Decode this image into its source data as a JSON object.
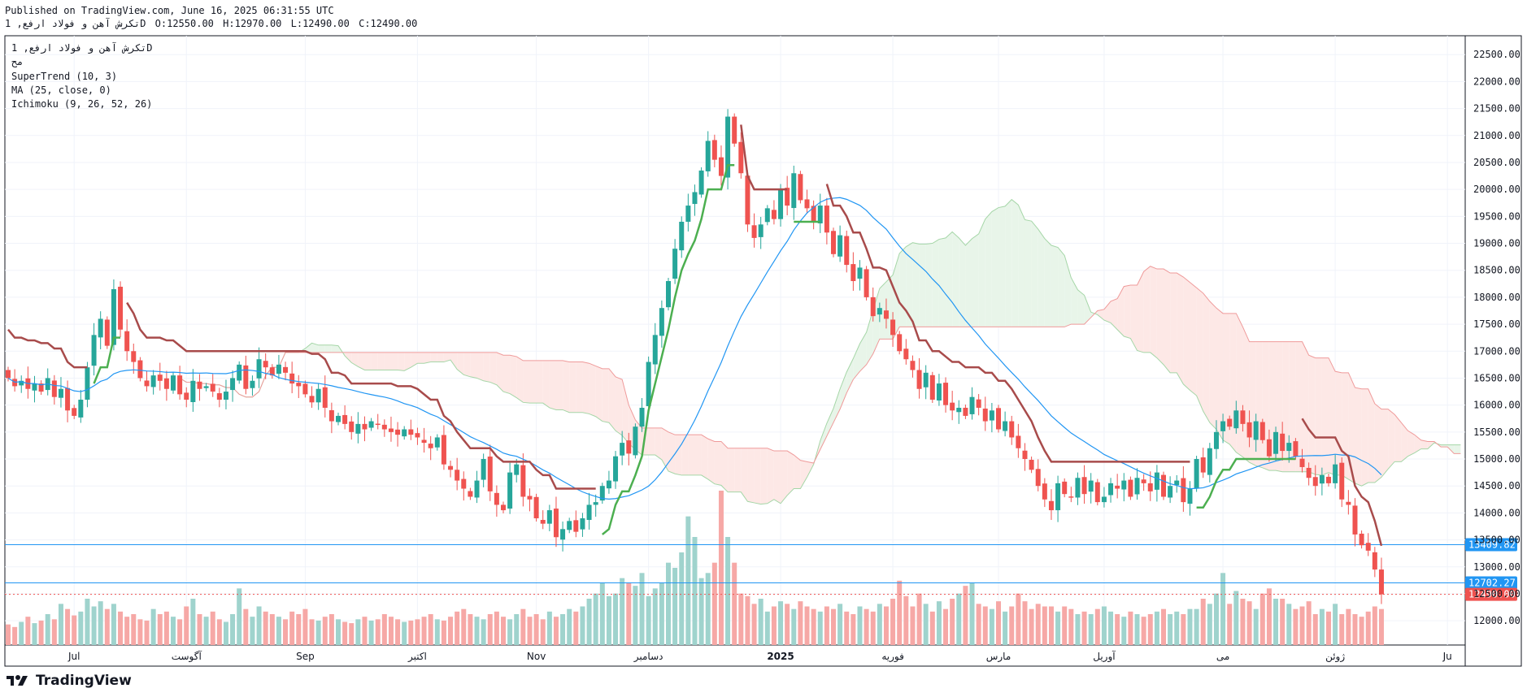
{
  "header": {
    "published": "Published on TradingView.com, June 16, 2025 06:31:55 UTC",
    "symbol_line": "تکرش آهن و فولاد ارفع, 1D",
    "ohlc": [
      "O:12550.00",
      "H:12970.00",
      "L:12490.00",
      "C:12490.00"
    ]
  },
  "legend": {
    "symbol": "تکرش آهن و فولاد ارفع, 1D",
    "exchange": "مح",
    "supertrend": "SuperTrend (10, 3)",
    "ma": "MA (25, close, 0)",
    "ichimoku": "Ichimoku (9, 26, 52, 26)"
  },
  "brand": "TradingView",
  "colors": {
    "up": "#26a69a",
    "down": "#ef5350",
    "supertrend_up": "#4caf50",
    "supertrend_down": "#a84b4b",
    "ma": "#2196f3",
    "cloud_bull": "#e8f5e9",
    "cloud_bear": "#fde8e6",
    "hline": "#2196f3",
    "price_label": "#ef5350"
  },
  "chart_data": {
    "type": "candlestick",
    "timeframe": "1D",
    "ylim": [
      11550,
      22850
    ],
    "y_ticks": [
      12000,
      12500,
      13000,
      13500,
      14000,
      14500,
      15000,
      15500,
      16000,
      16500,
      17000,
      17500,
      18000,
      18500,
      19000,
      19500,
      20000,
      20500,
      21000,
      21500,
      22000,
      22500
    ],
    "x_labels": [
      {
        "label": "Jul",
        "bar": 10
      },
      {
        "label": "آگوست",
        "bar": 27
      },
      {
        "label": "Sep",
        "bar": 45
      },
      {
        "label": "اکتبر",
        "bar": 62
      },
      {
        "label": "Nov",
        "bar": 80
      },
      {
        "label": "دسامبر",
        "bar": 97
      },
      {
        "label": "2025",
        "bar": 117
      },
      {
        "label": "فوریه",
        "bar": 134
      },
      {
        "label": "مارس",
        "bar": 150
      },
      {
        "label": "آوریل",
        "bar": 166
      },
      {
        "label": "می",
        "bar": 184
      },
      {
        "label": "ژوئن",
        "bar": 201
      },
      {
        "label": "Ju",
        "bar": 218
      }
    ],
    "closes": [
      16500,
      16350,
      16450,
      16300,
      16400,
      16250,
      16500,
      16150,
      16300,
      15900,
      15800,
      16100,
      16700,
      17300,
      17600,
      17100,
      18150,
      17400,
      17000,
      16800,
      16500,
      16350,
      16550,
      16450,
      16300,
      16550,
      16200,
      16100,
      16450,
      16300,
      16350,
      16250,
      16100,
      16250,
      16500,
      16750,
      16300,
      16450,
      16850,
      16700,
      16550,
      16750,
      16600,
      16400,
      16350,
      16200,
      16050,
      16300,
      15950,
      15700,
      15800,
      15650,
      15500,
      15650,
      15550,
      15700,
      15650,
      15550,
      15500,
      15450,
      15550,
      15450,
      15400,
      15300,
      15200,
      15400,
      14900,
      14800,
      14600,
      14450,
      14300,
      14600,
      15000,
      14400,
      14150,
      14050,
      14750,
      14900,
      14300,
      14250,
      13900,
      13800,
      14050,
      13550,
      13700,
      13850,
      13650,
      13900,
      14150,
      14200,
      14500,
      14600,
      15050,
      15300,
      15100,
      15600,
      15950,
      16800,
      17300,
      17800,
      18300,
      18900,
      19400,
      19700,
      19950,
      20350,
      20900,
      20550,
      20250,
      21350,
      20850,
      20300,
      19350,
      19100,
      19350,
      19650,
      19450,
      20000,
      19700,
      20300,
      19800,
      19650,
      19400,
      19700,
      19200,
      18800,
      19150,
      18600,
      18300,
      18550,
      18000,
      17650,
      17800,
      17600,
      17300,
      17000,
      16850,
      16650,
      16300,
      16600,
      16100,
      16400,
      16000,
      15900,
      15950,
      15800,
      16150,
      15950,
      15700,
      15900,
      15550,
      15700,
      15400,
      15200,
      15000,
      14800,
      14500,
      14250,
      14050,
      14550,
      14350,
      14300,
      14650,
      14350,
      14600,
      14200,
      14300,
      14550,
      14450,
      14600,
      14300,
      14650,
      14550,
      14400,
      14750,
      14300,
      14500,
      14600,
      14200,
      14450,
      15000,
      14750,
      15200,
      15500,
      15700,
      15600,
      15900,
      15650,
      15400,
      15700,
      15350,
      15050,
      15500,
      15150,
      15300,
      15050,
      14850,
      14650,
      14500,
      14700,
      14550,
      14900,
      14250,
      14150,
      13600,
      13400,
      13300,
      12950,
      12490
    ],
    "volumes": [
      80,
      70,
      90,
      110,
      85,
      95,
      120,
      100,
      160,
      140,
      115,
      130,
      180,
      150,
      170,
      140,
      160,
      130,
      110,
      120,
      100,
      95,
      140,
      120,
      130,
      110,
      100,
      150,
      180,
      120,
      110,
      130,
      100,
      90,
      120,
      220,
      140,
      110,
      150,
      130,
      120,
      110,
      100,
      130,
      120,
      140,
      100,
      95,
      110,
      120,
      100,
      90,
      85,
      100,
      110,
      95,
      100,
      120,
      110,
      100,
      90,
      95,
      100,
      110,
      120,
      100,
      95,
      110,
      130,
      140,
      120,
      110,
      100,
      120,
      130,
      110,
      100,
      120,
      140,
      110,
      120,
      100,
      130,
      110,
      120,
      140,
      130,
      150,
      180,
      200,
      240,
      190,
      200,
      260,
      240,
      230,
      280,
      190,
      220,
      240,
      320,
      300,
      360,
      500,
      420,
      260,
      280,
      320,
      600,
      420,
      320,
      200,
      190,
      160,
      180,
      130,
      150,
      170,
      160,
      140,
      170,
      150,
      140,
      130,
      150,
      140,
      160,
      130,
      120,
      150,
      140,
      130,
      160,
      150,
      180,
      250,
      190,
      150,
      200,
      160,
      130,
      170,
      140,
      180,
      200,
      230,
      240,
      160,
      150,
      140,
      170,
      130,
      150,
      200,
      170,
      140,
      160,
      150,
      150,
      130,
      150,
      140,
      120,
      130,
      120,
      140,
      150,
      130,
      120,
      110,
      130,
      120,
      110,
      120,
      130,
      140,
      120,
      130,
      120,
      140,
      140,
      180,
      160,
      200,
      280,
      160,
      210,
      180,
      170,
      140,
      200,
      220,
      180,
      180,
      160,
      140,
      150,
      170,
      120,
      140,
      130,
      160,
      120,
      140,
      120,
      110,
      130,
      150,
      140,
      200,
      190,
      220,
      260,
      140
    ],
    "indicators": {
      "supertrend": "SuperTrend (10, 3)",
      "ma": "MA (25, close, 0)",
      "ichimoku": "Ichimoku (9, 26, 52, 26)"
    },
    "horizontal_lines": [
      13409.82,
      12702.27
    ],
    "last_price": 12490.0,
    "price_labels": [
      "13409.82",
      "12702.27",
      "12490.00"
    ]
  }
}
